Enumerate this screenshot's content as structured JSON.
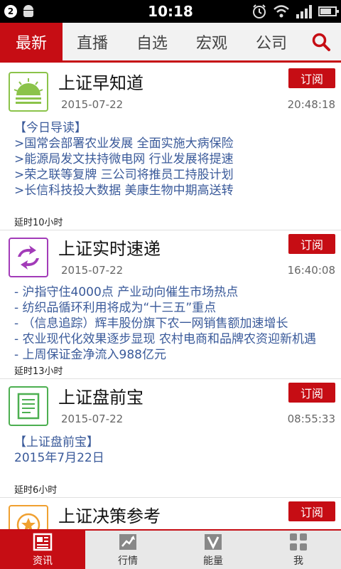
{
  "statusbar": {
    "notification_count": "2",
    "time": "10:18"
  },
  "nav": {
    "tabs": [
      {
        "label": "最新"
      },
      {
        "label": "直播"
      },
      {
        "label": "自选"
      },
      {
        "label": "宏观"
      },
      {
        "label": "公司"
      }
    ],
    "search_icon": "search-icon"
  },
  "feed": {
    "cards": [
      {
        "title": "上证早知道",
        "subscribe_label": "订阅",
        "date": "2015-07-22",
        "time": "20:48:18",
        "icon": "sunrise-icon",
        "lines": [
          "【今日导读】",
          ">国常会部署农业发展 全面实施大病保险",
          ">能源局发文扶持微电网 行业发展将提速",
          ">荣之联等复牌 三公司将推员工持股计划",
          ">长信科技投大数据 美康生物中期高送转"
        ],
        "delay": "延时10小时"
      },
      {
        "title": "上证实时速递",
        "subscribe_label": "订阅",
        "date": "2015-07-22",
        "time": "16:40:08",
        "icon": "refresh-arrows-icon",
        "lines": [
          "- 沪指守住4000点 产业动向催生市场热点",
          "- 纺织品循环利用将成为“十三五”重点",
          "- （信息追踪）辉丰股份旗下农一网销售额加速增长",
          "- 农业现代化效果逐步显现 农村电商和品牌农资迎新机遇",
          "- 上周保证金净流入988亿元"
        ],
        "delay": "延时13小时"
      },
      {
        "title": "上证盘前宝",
        "subscribe_label": "订阅",
        "date": "2015-07-22",
        "time": "08:55:33",
        "icon": "document-icon",
        "lines": [
          "【上证盘前宝】",
          "2015年7月22日"
        ],
        "delay": "延时6小时"
      },
      {
        "title": "上证决策参考",
        "subscribe_label": "订阅",
        "date": "",
        "time": "",
        "icon": "star-badge-icon",
        "lines": [],
        "delay": ""
      }
    ]
  },
  "bottombar": {
    "tabs": [
      {
        "label": "资讯",
        "icon": "news-icon"
      },
      {
        "label": "行情",
        "icon": "chart-icon"
      },
      {
        "label": "能量",
        "icon": "v-icon"
      },
      {
        "label": "我",
        "icon": "grid-icon"
      }
    ]
  },
  "colors": {
    "accent": "#c60d14",
    "link_text": "#3a5a9a"
  }
}
